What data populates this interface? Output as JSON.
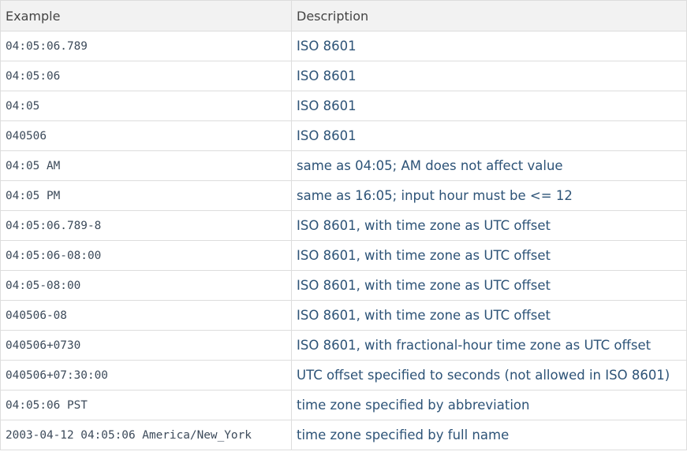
{
  "table": {
    "headers": [
      "Example",
      "Description"
    ],
    "rows": [
      {
        "example": "04:05:06.789",
        "description": "ISO 8601",
        "group_start": false
      },
      {
        "example": "04:05:06",
        "description": "ISO 8601",
        "group_start": false
      },
      {
        "example": "04:05",
        "description": "ISO 8601",
        "group_start": false
      },
      {
        "example": "040506",
        "description": "ISO 8601",
        "group_start": false
      },
      {
        "example": "04:05 AM",
        "description": "same as 04:05; AM does not affect value",
        "group_start": true
      },
      {
        "example": "04:05 PM",
        "description": "same as 16:05; input hour must be <= 12",
        "group_start": true
      },
      {
        "example": "04:05:06.789-8",
        "description": "ISO 8601, with time zone as UTC offset",
        "group_start": false
      },
      {
        "example": "04:05:06-08:00",
        "description": "ISO 8601, with time zone as UTC offset",
        "group_start": false
      },
      {
        "example": "04:05-08:00",
        "description": "ISO 8601, with time zone as UTC offset",
        "group_start": false
      },
      {
        "example": "040506-08",
        "description": "ISO 8601, with time zone as UTC offset",
        "group_start": false
      },
      {
        "example": "040506+0730",
        "description": "ISO 8601, with fractional-hour time zone as UTC offset",
        "group_start": false
      },
      {
        "example": "040506+07:30:00",
        "description": "UTC offset specified to seconds (not allowed in ISO 8601)",
        "group_start": false
      },
      {
        "example": "04:05:06 PST",
        "description": "time zone specified by abbreviation",
        "group_start": true
      },
      {
        "example": "2003-04-12 04:05:06 America/New_York",
        "description": "time zone specified by full name",
        "group_start": true
      }
    ]
  }
}
